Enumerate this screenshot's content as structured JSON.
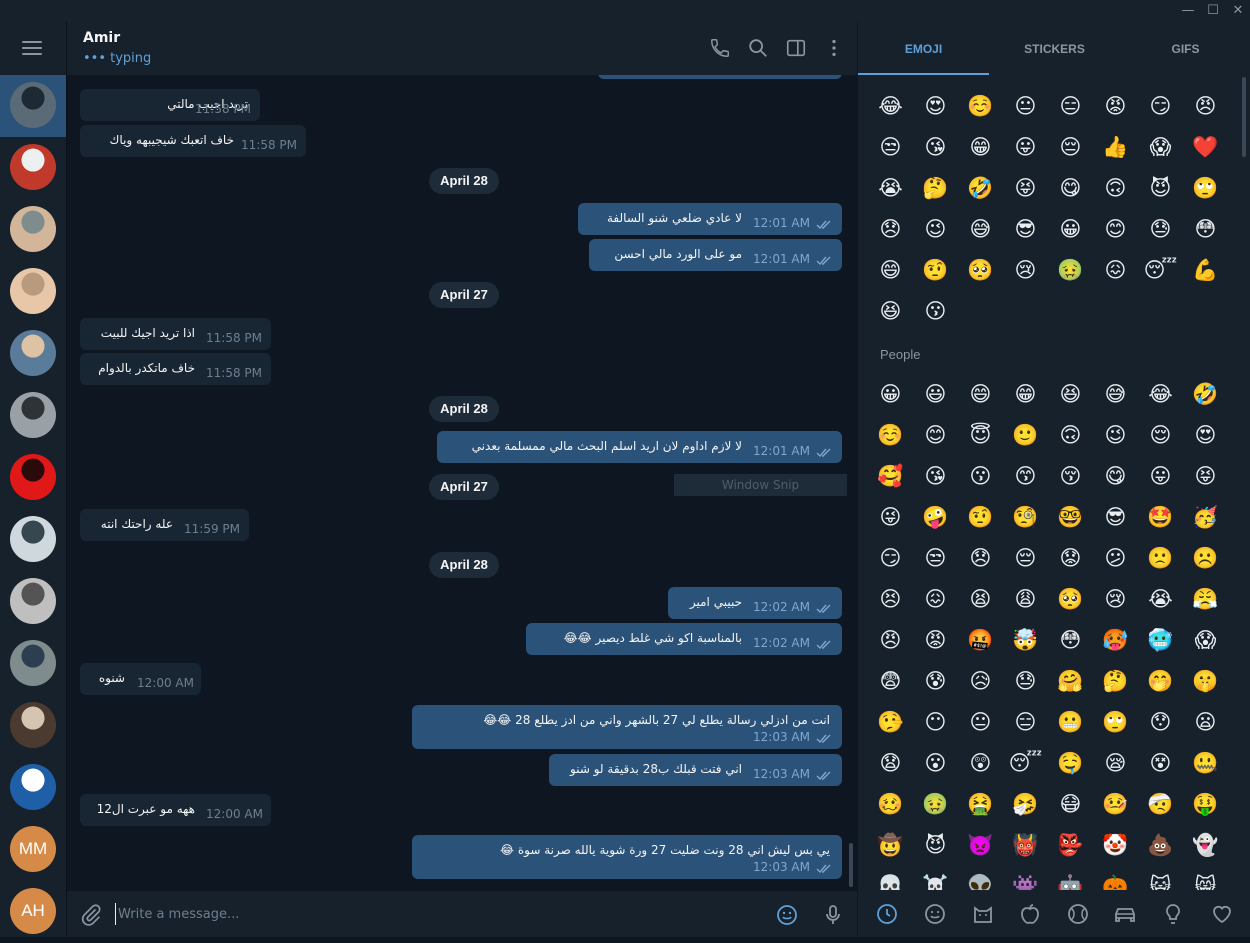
{
  "window": {
    "minimize": "—",
    "maximize": "☐",
    "close": "✕"
  },
  "sidebar": {
    "chats": [
      {
        "kind": "photo",
        "colors": [
          "#5a6b77",
          "#1e2a33"
        ]
      },
      {
        "kind": "photo",
        "colors": [
          "#c0392b",
          "#ecf0f1"
        ]
      },
      {
        "kind": "photo",
        "colors": [
          "#d3b59a",
          "#7f8c8d"
        ]
      },
      {
        "kind": "photo",
        "colors": [
          "#e7c7a8",
          "#b89a7e"
        ]
      },
      {
        "kind": "photo",
        "colors": [
          "#5a7b9a",
          "#ddc2a3"
        ]
      },
      {
        "kind": "photo",
        "colors": [
          "#9aa1a6",
          "#2e3338"
        ]
      },
      {
        "kind": "photo",
        "colors": [
          "#e01818",
          "#2a0a0a"
        ]
      },
      {
        "kind": "photo",
        "colors": [
          "#cfd8dc",
          "#37474f"
        ]
      },
      {
        "kind": "photo",
        "colors": [
          "#bfbfbf",
          "#545454"
        ]
      },
      {
        "kind": "photo",
        "colors": [
          "#7f8c8d",
          "#2c3e50"
        ]
      },
      {
        "kind": "photo",
        "colors": [
          "#4b3a2f",
          "#d6c4b3"
        ]
      },
      {
        "kind": "photo",
        "colors": [
          "#1f5fa8",
          "#ffffff"
        ]
      },
      {
        "kind": "initials",
        "text": "MM"
      },
      {
        "kind": "initials",
        "text": "AH"
      }
    ]
  },
  "header": {
    "title": "Amir",
    "status": "••• typing"
  },
  "messages": [
    {
      "dir": "in",
      "text": "تريد اجيب مالتي",
      "time": "11:58 PM"
    },
    {
      "dir": "in",
      "text": "خاف اتعبك شيجيبهه وياك",
      "time": "11:58 PM"
    },
    {
      "date": "April 28"
    },
    {
      "dir": "out",
      "text": "لا عادي ضلعي شنو السالفة",
      "time": "12:01 AM"
    },
    {
      "dir": "out",
      "text": "مو على الورد مالي احسن",
      "time": "12:01 AM"
    },
    {
      "date": "April 27"
    },
    {
      "dir": "in",
      "text": "اذا تريد اجيك للبيت",
      "time": "11:58 PM"
    },
    {
      "dir": "in",
      "text": "خاف ماتكدر بالدوام",
      "time": "11:58 PM"
    },
    {
      "date": "April 28"
    },
    {
      "dir": "out",
      "text": "لا لازم اداوم لان اريد اسلم البحث مالي ممسلمة بعدني",
      "time": "12:01 AM"
    },
    {
      "date": "April 27"
    },
    {
      "dir": "in",
      "text": "عله راحتك انته",
      "time": "11:59 PM"
    },
    {
      "date": "April 28"
    },
    {
      "dir": "out",
      "text": "حبيبي امير",
      "time": "12:02 AM"
    },
    {
      "dir": "out",
      "text": "بالمناسبة اكو شي غلط ديصير 😂😂",
      "time": "12:02 AM"
    },
    {
      "dir": "in",
      "text": "شنوه",
      "time": "12:00 AM"
    },
    {
      "dir": "out",
      "text": "انت من ادزلي رسالة يطلع لي 27 بالشهر واني من ادز يطلع 28 😂😂",
      "time": "12:03 AM"
    },
    {
      "dir": "out",
      "text": "اني فتت قبلك ب28 بدقيقة لو شنو",
      "time": "12:03 AM"
    },
    {
      "dir": "in",
      "text": "ههه مو عبرت ال12",
      "time": "12:00 AM"
    },
    {
      "dir": "out",
      "text": "يي بس ليش اني 28 ونت ضليت 27 ورة شوية يالله صرنة سوة 😂",
      "time": "12:03 AM"
    }
  ],
  "overlay": {
    "snip": "Window Snip"
  },
  "composer": {
    "placeholder": "Write a message..."
  },
  "panel": {
    "tabs": [
      "EMOJI",
      "STICKERS",
      "GIFS"
    ],
    "active_tab": "EMOJI",
    "recent": [
      "😂",
      "😍",
      "☺️",
      "😐",
      "😑",
      "😡",
      "😏",
      "😠",
      "😒",
      "😘",
      "😁",
      "😛",
      "😔",
      "👍",
      "😱",
      "❤️",
      "😭",
      "🤔",
      "🤣",
      "😝",
      "😋",
      "🙃",
      "😈",
      "🙄",
      "😞",
      "😉",
      "😅",
      "😎",
      "😀",
      "😊",
      "😓",
      "😳",
      "😄",
      "🤨",
      "🥺",
      "😢",
      "🤢",
      "😖",
      "😴",
      "💪",
      "😆",
      "😗"
    ],
    "people_title": "People",
    "people": [
      "😀",
      "😃",
      "😄",
      "😁",
      "😆",
      "😅",
      "😂",
      "🤣",
      "☺️",
      "😊",
      "😇",
      "🙂",
      "🙃",
      "😉",
      "😌",
      "😍",
      "🥰",
      "😘",
      "😗",
      "😙",
      "😚",
      "😋",
      "😛",
      "😝",
      "😜",
      "🤪",
      "🤨",
      "🧐",
      "🤓",
      "😎",
      "🤩",
      "🥳",
      "😏",
      "😒",
      "😞",
      "😔",
      "😟",
      "😕",
      "🙁",
      "☹️",
      "😣",
      "😖",
      "😫",
      "😩",
      "🥺",
      "😢",
      "😭",
      "😤",
      "😠",
      "😡",
      "🤬",
      "🤯",
      "😳",
      "🥵",
      "🥶",
      "😱",
      "😨",
      "😰",
      "😥",
      "😓",
      "🤗",
      "🤔",
      "🤭",
      "🤫",
      "🤥",
      "😶",
      "😐",
      "😑",
      "😬",
      "🙄",
      "😯",
      "😦",
      "😧",
      "😮",
      "😲",
      "😴",
      "🤤",
      "😪",
      "😵",
      "🤐",
      "🥴",
      "🤢",
      "🤮",
      "🤧",
      "😷",
      "🤒",
      "🤕",
      "🤑",
      "🤠",
      "😈",
      "👿",
      "👹",
      "👺",
      "🤡",
      "💩",
      "👻",
      "💀",
      "☠️",
      "👽",
      "👾",
      "🤖",
      "🎃",
      "😺",
      "😸"
    ]
  },
  "categories": [
    "recent-icon",
    "smile-icon",
    "cat-icon",
    "apple-icon",
    "ball-icon",
    "car-icon",
    "bulb-icon",
    "heart-icon"
  ]
}
